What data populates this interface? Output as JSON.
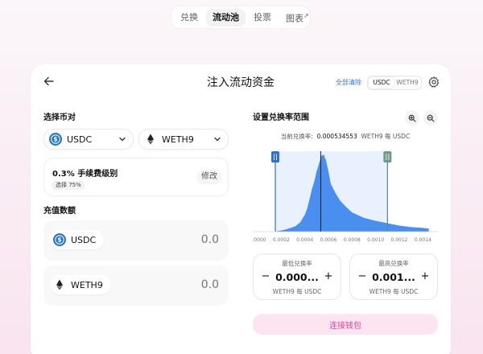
{
  "nav": {
    "items": [
      {
        "label": "兑换"
      },
      {
        "label": "流动池"
      },
      {
        "label": "投票"
      },
      {
        "label": "图表"
      }
    ],
    "external_mark": "↗"
  },
  "header": {
    "title": "注入流动资金",
    "clear_all": "全部清除",
    "toggle": [
      "USDC",
      "WETH9"
    ]
  },
  "pair": {
    "label": "选择币对",
    "token_a": "USDC",
    "token_b": "WETH9"
  },
  "fee": {
    "title": "0.3% 手续费级别",
    "badge": "选择 75%",
    "edit": "修改"
  },
  "deposit": {
    "label": "充值数额",
    "token_a": "USDC",
    "token_a_value": "0.0",
    "token_b": "WETH9",
    "token_b_value": "0.0"
  },
  "range": {
    "label": "设置兑换率范围",
    "current_label": "当前兑换率:",
    "current_value": "0.000534553",
    "current_unit": "WETH9 每 USDC",
    "min_label": "最低兑换率",
    "min_value": "0.000...",
    "min_unit": "WETH9 每 USDC",
    "max_label": "最高兑换率",
    "max_value": "0.001...",
    "max_unit": "WETH9 每 USDC"
  },
  "connect_label": "连接钱包",
  "colors": {
    "accent_blue": "#3774e8",
    "pink": "#e0419b",
    "pink_bg": "#fce5f0",
    "histogram": "#4a8ff0"
  },
  "chart_data": {
    "type": "area",
    "x_ticks": [
      "0.0000",
      "0.0002",
      "0.0004",
      "0.0006",
      "0.0008",
      "0.0010",
      "0.0012",
      "0.0014"
    ],
    "xlim": [
      0,
      0.0015
    ],
    "current_price": 0.000534553,
    "range_min": 0.00015,
    "range_max": 0.0011,
    "x": [
      0.00016,
      0.0002,
      0.00024,
      0.00028,
      0.00032,
      0.00036,
      0.0004,
      0.00042,
      0.00044,
      0.00046,
      0.00048,
      0.0005,
      0.00052,
      0.00054,
      0.00056,
      0.00058,
      0.0006,
      0.00062,
      0.00066,
      0.0007,
      0.00075,
      0.0008,
      0.0009,
      0.001,
      0.0011,
      0.0012,
      0.0013,
      0.0014,
      0.00145
    ],
    "values": [
      0.5,
      1.5,
      3,
      5,
      7,
      12,
      22,
      30,
      42,
      55,
      65,
      78,
      88,
      98,
      100,
      92,
      78,
      62,
      50,
      40,
      32,
      25,
      18,
      14,
      11,
      8,
      6,
      5,
      4
    ]
  }
}
